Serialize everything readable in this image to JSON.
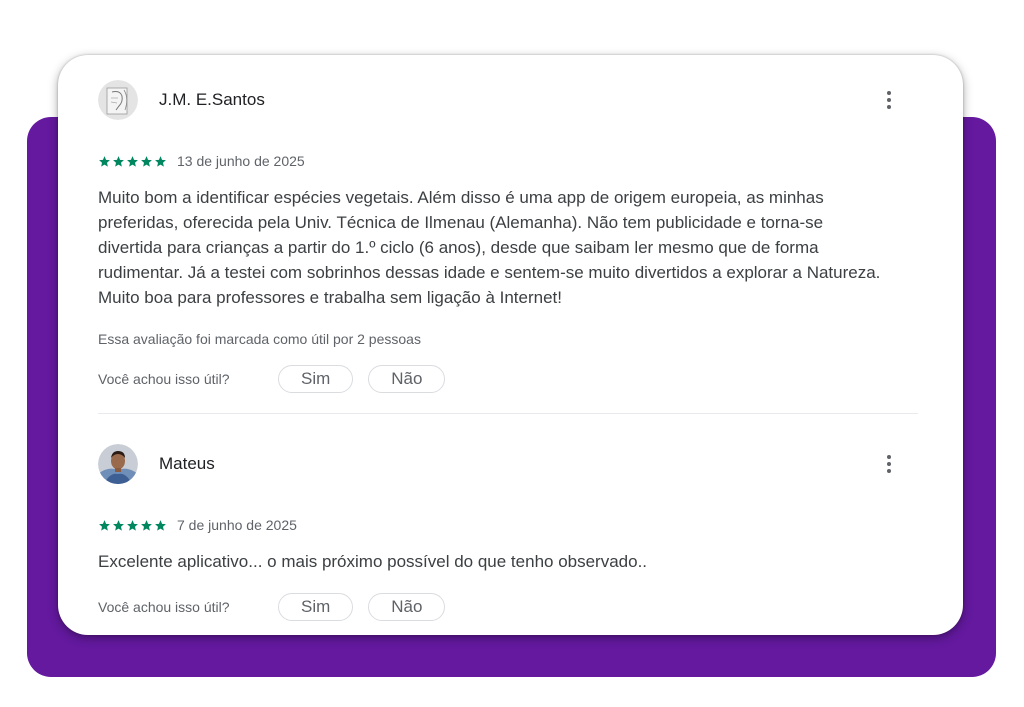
{
  "theme": {
    "backdrop_color": "#64199f",
    "star_color": "#01875f"
  },
  "reviews": [
    {
      "author": "J.M. E.Santos",
      "rating": 5,
      "date": "13 de junho de 2025",
      "text": "Muito bom a identificar espécies vegetais. Além disso é uma app de origem europeia, as minhas preferidas, oferecida pela Univ. Técnica de Ilmenau (Alemanha). Não tem publicidade e torna-se divertida para crianças a partir do 1.º ciclo (6 anos), desde que saibam ler mesmo que de forma rudimentar. Já a testei com sobrinhos dessas idade e sentem-se muito divertidos a explorar a Natureza. Muito boa para professores e trabalha sem ligação à Internet!",
      "helpful_count": "Essa avaliação foi marcada como útil por 2 pessoas",
      "helpful_question": "Você achou isso útil?",
      "yes_label": "Sim",
      "no_label": "Não"
    },
    {
      "author": "Mateus",
      "rating": 5,
      "date": "7 de junho de 2025",
      "text": "Excelente aplicativo... o mais próximo possível do que tenho observado..",
      "helpful_question": "Você achou isso útil?",
      "yes_label": "Sim",
      "no_label": "Não"
    }
  ]
}
